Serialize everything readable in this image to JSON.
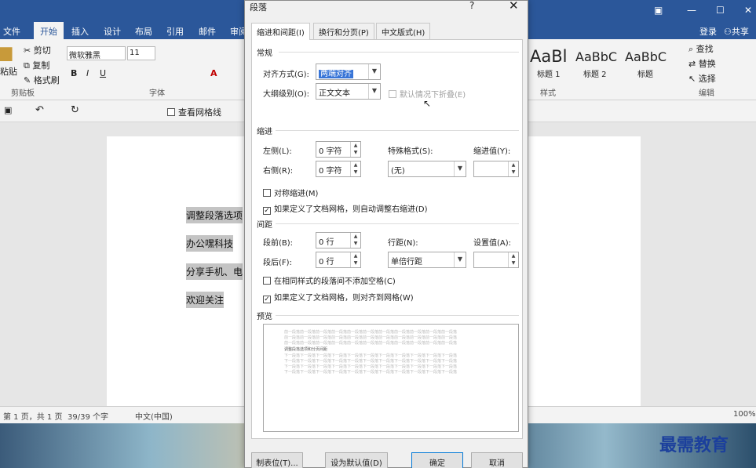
{
  "word": {
    "file_tab": "文件",
    "ribbon_tabs": [
      "开始",
      "插入",
      "设计",
      "布局",
      "引用",
      "邮件",
      "审阅"
    ],
    "login": "登录",
    "share": "共享",
    "clipboard": {
      "paste": "粘贴",
      "cut": "剪切",
      "copy": "复制",
      "format_painter": "格式刷",
      "group": "剪贴板"
    },
    "font": {
      "name": "微软雅黑",
      "size": "11",
      "group": "字体"
    },
    "styles": {
      "items": [
        {
          "preview": "AaBl",
          "name": "标题 1"
        },
        {
          "preview": "AaBbC",
          "name": "标题 2"
        },
        {
          "preview": "AaBbC",
          "name": "标题"
        }
      ],
      "group": "样式"
    },
    "editing": {
      "find": "查找",
      "replace": "替换",
      "select": "选择",
      "group": "编辑"
    },
    "view_gridlines": "查看网格线",
    "doc_lines": [
      "调整段落选项",
      "办公嘿科技",
      "分享手机、电",
      "欢迎关注"
    ],
    "status": {
      "page": "第 1 页，共 1 页",
      "words": "39/39 个字",
      "lang": "中文(中国)",
      "zoom": "100%"
    }
  },
  "dialog": {
    "title": "段落",
    "help": "?",
    "close": "✕",
    "tabs": [
      "缩进和间距(I)",
      "换行和分页(P)",
      "中文版式(H)"
    ],
    "general": {
      "section": "常规",
      "align_label": "对齐方式(G):",
      "align_value": "两端对齐",
      "outline_label": "大纲级别(O):",
      "outline_value": "正文文本",
      "collapse_label": "默认情况下折叠(E)"
    },
    "indent": {
      "section": "缩进",
      "left_label": "左侧(L):",
      "left_value": "0 字符",
      "right_label": "右侧(R):",
      "right_value": "0 字符",
      "special_label": "特殊格式(S):",
      "special_value": "(无)",
      "by_label": "缩进值(Y):",
      "mirror_label": "对称缩进(M)",
      "auto_right_label": "如果定义了文档网格，则自动调整右缩进(D)"
    },
    "spacing": {
      "section": "间距",
      "before_label": "段前(B):",
      "before_value": "0 行",
      "after_label": "段后(F):",
      "after_value": "0 行",
      "line_label": "行距(N):",
      "line_value": "单倍行距",
      "at_label": "设置值(A):",
      "no_space_label": "在相同样式的段落间不添加空格(C)",
      "snap_grid_label": "如果定义了文档网格，则对齐到网格(W)"
    },
    "preview": {
      "section": "预览",
      "prev_text": "前一段落前一段落前一段落前一段落前一段落前一段落前一段落前一段落前一段落前一段落前一段落",
      "sample_text": "调整段落选项和分页间距",
      "next_text": "下一段落下一段落下一段落下一段落下一段落下一段落下一段落下一段落下一段落下一段落下一段落"
    },
    "buttons": {
      "tabs": "制表位(T)...",
      "set_default": "设为默认值(D)",
      "ok": "确定",
      "cancel": "取消"
    }
  },
  "watermark": "最需教育"
}
